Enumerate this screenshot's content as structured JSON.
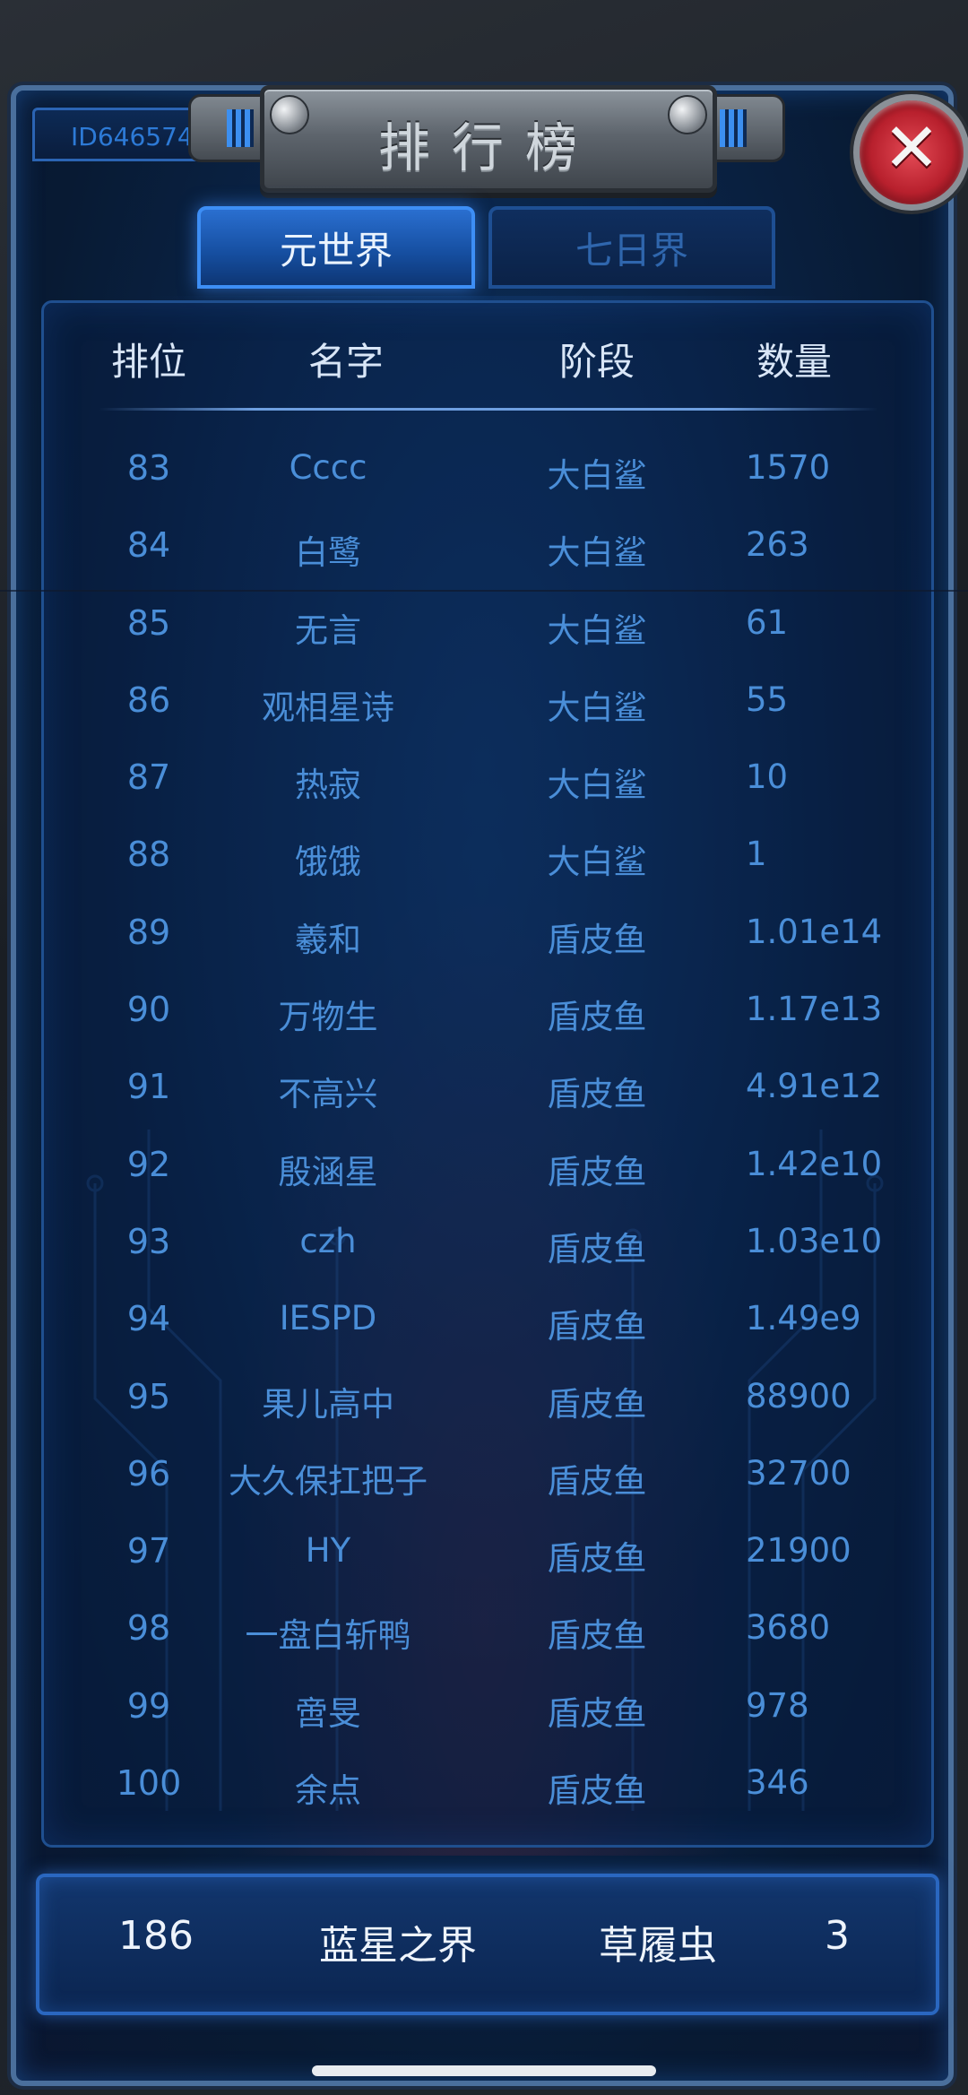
{
  "player_id": "ID646574",
  "title": "排行榜",
  "close_icon": "close-icon",
  "tabs": [
    {
      "label": "元世界",
      "active": true
    },
    {
      "label": "七日界",
      "active": false
    }
  ],
  "table": {
    "headers": [
      "排位",
      "名字",
      "阶段",
      "数量"
    ],
    "rows": [
      {
        "rank": "83",
        "name": "Cccc",
        "stage": "大白鲨",
        "count": "1570"
      },
      {
        "rank": "84",
        "name": "白鹭",
        "stage": "大白鲨",
        "count": "263"
      },
      {
        "rank": "85",
        "name": "无言",
        "stage": "大白鲨",
        "count": "61"
      },
      {
        "rank": "86",
        "name": "观相星诗",
        "stage": "大白鲨",
        "count": "55"
      },
      {
        "rank": "87",
        "name": "热寂",
        "stage": "大白鲨",
        "count": "10"
      },
      {
        "rank": "88",
        "name": "饿饿",
        "stage": "大白鲨",
        "count": "1"
      },
      {
        "rank": "89",
        "name": "羲和",
        "stage": "盾皮鱼",
        "count": "1.01e14"
      },
      {
        "rank": "90",
        "name": "万物生",
        "stage": "盾皮鱼",
        "count": "1.17e13"
      },
      {
        "rank": "91",
        "name": "不高兴",
        "stage": "盾皮鱼",
        "count": "4.91e12"
      },
      {
        "rank": "92",
        "name": "殷涵星",
        "stage": "盾皮鱼",
        "count": "1.42e10"
      },
      {
        "rank": "93",
        "name": "czh",
        "stage": "盾皮鱼",
        "count": "1.03e10"
      },
      {
        "rank": "94",
        "name": "IESPD",
        "stage": "盾皮鱼",
        "count": "1.49e9"
      },
      {
        "rank": "95",
        "name": "果儿高中",
        "stage": "盾皮鱼",
        "count": "88900"
      },
      {
        "rank": "96",
        "name": "大久保扛把子",
        "stage": "盾皮鱼",
        "count": "32700"
      },
      {
        "rank": "97",
        "name": "HY",
        "stage": "盾皮鱼",
        "count": "21900"
      },
      {
        "rank": "98",
        "name": "一盘白斩鸭",
        "stage": "盾皮鱼",
        "count": "3680"
      },
      {
        "rank": "99",
        "name": "啻旻",
        "stage": "盾皮鱼",
        "count": "978"
      },
      {
        "rank": "100",
        "name": "余点",
        "stage": "盾皮鱼",
        "count": "346"
      }
    ]
  },
  "my_rank": {
    "rank": "186",
    "name": "蓝星之界",
    "stage": "草履虫",
    "count": "3"
  },
  "colors": {
    "accent": "#3d8ef5",
    "row_text": "#4a8ed8",
    "header_text": "#d9e6f7",
    "close_red": "#b8202d"
  }
}
